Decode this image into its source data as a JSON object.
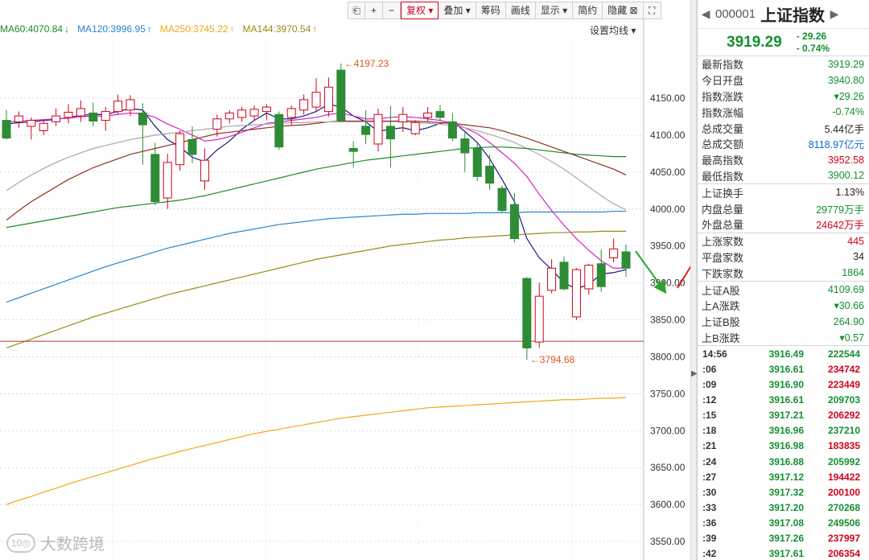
{
  "toolbar": {
    "buttons": [
      {
        "label": "⎗",
        "icon": "copy-icon"
      },
      {
        "label": "+",
        "icon": "zoom-in-icon"
      },
      {
        "label": "−",
        "icon": "zoom-out-icon"
      },
      {
        "label": "复权 ▾",
        "active": true
      },
      {
        "label": "叠加 ▾"
      },
      {
        "label": "筹码"
      },
      {
        "label": "画线"
      },
      {
        "label": "显示 ▾"
      },
      {
        "label": "简约"
      },
      {
        "label": "隐藏 ⊠"
      },
      {
        "label": "⛶",
        "icon": "fullscreen-icon"
      }
    ]
  },
  "ma_legend": [
    {
      "label": "MA60:4070.84",
      "arrow": "↓",
      "color": "#1b8a28"
    },
    {
      "label": "MA120:3996.95",
      "arrow": "↑",
      "color": "#2a86d1"
    },
    {
      "label": "MA250:3745.22",
      "arrow": "↑",
      "color": "#f0a818"
    },
    {
      "label": "MA144:3970.54",
      "arrow": "↑",
      "color": "#9a8a1a"
    }
  ],
  "ma_settings": "设置均线 ▾",
  "watermark": "大数跨境",
  "chart_data": {
    "type": "candlestick",
    "y_ticks": [
      4150,
      4100,
      4050,
      4000,
      3950,
      3900,
      3850,
      3800,
      3750,
      3700,
      3650,
      3600,
      3550
    ],
    "ylim": [
      3525,
      4235
    ],
    "candles": [
      {
        "o": 4120,
        "h": 4134,
        "l": 4094,
        "c": 4096
      },
      {
        "o": 4118,
        "h": 4132,
        "l": 4110,
        "c": 4126
      },
      {
        "o": 4112,
        "h": 4124,
        "l": 4094,
        "c": 4120
      },
      {
        "o": 4106,
        "h": 4121,
        "l": 4100,
        "c": 4116
      },
      {
        "o": 4118,
        "h": 4136,
        "l": 4112,
        "c": 4126
      },
      {
        "o": 4124,
        "h": 4142,
        "l": 4116,
        "c": 4131
      },
      {
        "o": 4126,
        "h": 4147,
        "l": 4118,
        "c": 4136
      },
      {
        "o": 4130,
        "h": 4144,
        "l": 4112,
        "c": 4119
      },
      {
        "o": 4120,
        "h": 4138,
        "l": 4106,
        "c": 4132
      },
      {
        "o": 4132,
        "h": 4155,
        "l": 4128,
        "c": 4146
      },
      {
        "o": 4134,
        "h": 4154,
        "l": 4126,
        "c": 4148
      },
      {
        "o": 4130,
        "h": 4143,
        "l": 4060,
        "c": 4114
      },
      {
        "o": 4074,
        "h": 4090,
        "l": 4005,
        "c": 4010
      },
      {
        "o": 4015,
        "h": 4075,
        "l": 4000,
        "c": 4063
      },
      {
        "o": 4060,
        "h": 4106,
        "l": 4052,
        "c": 4102
      },
      {
        "o": 4094,
        "h": 4112,
        "l": 4062,
        "c": 4074
      },
      {
        "o": 4038,
        "h": 4082,
        "l": 4026,
        "c": 4066
      },
      {
        "o": 4108,
        "h": 4128,
        "l": 4098,
        "c": 4122
      },
      {
        "o": 4122,
        "h": 4134,
        "l": 4116,
        "c": 4130
      },
      {
        "o": 4124,
        "h": 4138,
        "l": 4118,
        "c": 4134
      },
      {
        "o": 4126,
        "h": 4140,
        "l": 4120,
        "c": 4135
      },
      {
        "o": 4132,
        "h": 4142,
        "l": 4120,
        "c": 4138
      },
      {
        "o": 4128,
        "h": 4132,
        "l": 4080,
        "c": 4084
      },
      {
        "o": 4124,
        "h": 4140,
        "l": 4114,
        "c": 4136
      },
      {
        "o": 4134,
        "h": 4155,
        "l": 4128,
        "c": 4148
      },
      {
        "o": 4138,
        "h": 4177,
        "l": 4132,
        "c": 4158
      },
      {
        "o": 4132,
        "h": 4178,
        "l": 4125,
        "c": 4165
      },
      {
        "o": 4188,
        "h": 4197,
        "l": 4118,
        "c": 4120
      },
      {
        "o": 4082,
        "h": 4092,
        "l": 4056,
        "c": 4078
      },
      {
        "o": 4112,
        "h": 4134,
        "l": 4088,
        "c": 4101
      },
      {
        "o": 4088,
        "h": 4136,
        "l": 4078,
        "c": 4128
      },
      {
        "o": 4112,
        "h": 4140,
        "l": 4056,
        "c": 4095
      },
      {
        "o": 4118,
        "h": 4138,
        "l": 4104,
        "c": 4128
      },
      {
        "o": 4102,
        "h": 4120,
        "l": 4100,
        "c": 4117
      },
      {
        "o": 4124,
        "h": 4138,
        "l": 4118,
        "c": 4130
      },
      {
        "o": 4132,
        "h": 4141,
        "l": 4120,
        "c": 4124
      },
      {
        "o": 4118,
        "h": 4130,
        "l": 4092,
        "c": 4096
      },
      {
        "o": 4095,
        "h": 4104,
        "l": 4050,
        "c": 4076
      },
      {
        "o": 4082,
        "h": 4090,
        "l": 4038,
        "c": 4044
      },
      {
        "o": 4058,
        "h": 4074,
        "l": 4026,
        "c": 4035
      },
      {
        "o": 4028,
        "h": 4032,
        "l": 3996,
        "c": 3998
      },
      {
        "o": 4006,
        "h": 4022,
        "l": 3955,
        "c": 3960
      },
      {
        "o": 3906,
        "h": 3908,
        "l": 3796,
        "c": 3812
      },
      {
        "o": 3820,
        "h": 3900,
        "l": 3812,
        "c": 3882
      },
      {
        "o": 3890,
        "h": 3932,
        "l": 3886,
        "c": 3920
      },
      {
        "o": 3928,
        "h": 3936,
        "l": 3890,
        "c": 3892
      },
      {
        "o": 3854,
        "h": 3920,
        "l": 3850,
        "c": 3918
      },
      {
        "o": 3892,
        "h": 3926,
        "l": 3884,
        "c": 3924
      },
      {
        "o": 3926,
        "h": 3945,
        "l": 3888,
        "c": 3895
      },
      {
        "o": 3934,
        "h": 3960,
        "l": 3928,
        "c": 3946
      },
      {
        "o": 3942,
        "h": 3952,
        "l": 3908,
        "c": 3920
      }
    ],
    "ma_lines": [
      {
        "name": "MA5",
        "color": "#1a1a80",
        "values": [
          4115,
          4117,
          4118,
          4120,
          4121,
          4124,
          4127,
          4128,
          4128,
          4132,
          4136,
          4134,
          4112,
          4094,
          4084,
          4070,
          4064,
          4080,
          4092,
          4108,
          4120,
          4130,
          4122,
          4122,
          4126,
          4132,
          4142,
          4138,
          4126,
          4118,
          4105,
          4108,
          4110,
          4106,
          4110,
          4116,
          4118,
          4105,
          4090,
          4068,
          4040,
          4010,
          3960,
          3934,
          3918,
          3900,
          3892,
          3898,
          3912,
          3914,
          3918
        ]
      },
      {
        "name": "MA10",
        "color": "#d920c8",
        "values": [
          4118,
          4119,
          4120,
          4121,
          4122,
          4123,
          4125,
          4126,
          4126,
          4128,
          4130,
          4129,
          4124,
          4115,
          4108,
          4100,
          4092,
          4094,
          4098,
          4104,
          4110,
          4116,
          4118,
          4120,
          4122,
          4124,
          4128,
          4130,
          4126,
          4122,
          4122,
          4124,
          4125,
          4124,
          4122,
          4120,
          4116,
          4110,
          4102,
          4090,
          4076,
          4062,
          4044,
          4020,
          3998,
          3978,
          3960,
          3944,
          3930,
          3920,
          3920
        ]
      },
      {
        "name": "MA20",
        "color": "#8c3020",
        "values": [
          3985,
          3998,
          4010,
          4020,
          4030,
          4040,
          4048,
          4056,
          4062,
          4068,
          4074,
          4078,
          4082,
          4086,
          4090,
          4094,
          4098,
          4102,
          4104,
          4106,
          4108,
          4110,
          4112,
          4113,
          4114,
          4116,
          4118,
          4119,
          4119,
          4119,
          4119,
          4119,
          4119,
          4119,
          4118,
          4117,
          4116,
          4114,
          4112,
          4110,
          4106,
          4101,
          4096,
          4090,
          4084,
          4078,
          4072,
          4066,
          4060,
          4054,
          4046
        ]
      },
      {
        "name": "MA30",
        "color": "#a8a8a8",
        "values": [
          4025,
          4036,
          4046,
          4055,
          4063,
          4070,
          4076,
          4082,
          4086,
          4090,
          4094,
          4097,
          4100,
          4102,
          4104,
          4106,
          4108,
          4110,
          4112,
          4113,
          4114,
          4115,
          4116,
          4117,
          4117,
          4118,
          4118,
          4118,
          4118,
          4118,
          4118,
          4118,
          4118,
          4117,
          4116,
          4115,
          4113,
          4110,
          4106,
          4101,
          4096,
          4090,
          4082,
          4074,
          4064,
          4054,
          4042,
          4030,
          4018,
          4007,
          3999
        ]
      },
      {
        "name": "MA60",
        "color": "#1b8a28",
        "values": [
          3975,
          3978,
          3981,
          3984,
          3987,
          3990,
          3993,
          3996,
          3999,
          4002,
          4004,
          4006,
          4008,
          4010,
          4012,
          4015,
          4018,
          4022,
          4026,
          4030,
          4034,
          4038,
          4042,
          4046,
          4050,
          4054,
          4057,
          4060,
          4063,
          4066,
          4068,
          4070,
          4072,
          4074,
          4076,
          4078,
          4080,
          4082,
          4083,
          4084,
          4084,
          4083,
          4082,
          4080,
          4078,
          4076,
          4074,
          4073,
          4072,
          4071,
          4071
        ]
      },
      {
        "name": "MA120",
        "color": "#2a86d1",
        "values": [
          3874,
          3880,
          3886,
          3892,
          3898,
          3904,
          3910,
          3916,
          3922,
          3927,
          3932,
          3937,
          3942,
          3947,
          3951,
          3955,
          3959,
          3963,
          3967,
          3970,
          3973,
          3976,
          3979,
          3981,
          3983,
          3985,
          3987,
          3988,
          3989,
          3990,
          3991,
          3992,
          3993,
          3993,
          3994,
          3994,
          3994,
          3994,
          3995,
          3995,
          3995,
          3995,
          3996,
          3996,
          3996,
          3996,
          3996,
          3996,
          3996,
          3997,
          3997
        ]
      },
      {
        "name": "MA144",
        "color": "#9a8a1a",
        "values": [
          3812,
          3818,
          3824,
          3830,
          3836,
          3842,
          3848,
          3854,
          3859,
          3864,
          3869,
          3874,
          3879,
          3884,
          3888,
          3892,
          3896,
          3900,
          3904,
          3908,
          3912,
          3916,
          3920,
          3924,
          3928,
          3932,
          3935,
          3938,
          3941,
          3944,
          3947,
          3950,
          3952,
          3954,
          3956,
          3958,
          3959,
          3961,
          3962,
          3963,
          3964,
          3965,
          3966,
          3967,
          3968,
          3968,
          3969,
          3969,
          3970,
          3970,
          3970
        ]
      },
      {
        "name": "MA250",
        "color": "#f0a818",
        "values": [
          3600,
          3606,
          3611,
          3617,
          3622,
          3628,
          3633,
          3638,
          3643,
          3648,
          3653,
          3658,
          3663,
          3667,
          3672,
          3676,
          3680,
          3684,
          3688,
          3692,
          3696,
          3699,
          3702,
          3705,
          3708,
          3711,
          3714,
          3717,
          3719,
          3721,
          3723,
          3725,
          3727,
          3729,
          3731,
          3732,
          3733,
          3734,
          3735,
          3736,
          3737,
          3738,
          3739,
          3740,
          3741,
          3742,
          3742,
          3743,
          3744,
          3744,
          3745
        ]
      }
    ],
    "support_line": 3821,
    "annotations": {
      "high": "←4197.23",
      "low": "←3794.68"
    }
  },
  "side": {
    "code": "000001",
    "name": "上证指数",
    "price": "3919.29",
    "change": "- 29.26",
    "change_pct": "- 0.74%",
    "stats_a": [
      {
        "k": "最新指数",
        "v": "3919.29",
        "cls": "green"
      },
      {
        "k": "今日开盘",
        "v": "3940.80",
        "cls": "green"
      },
      {
        "k": "指数涨跌",
        "v": "▾29.26",
        "cls": "green"
      },
      {
        "k": "指数涨幅",
        "v": "-0.74%",
        "cls": "green"
      },
      {
        "k": "总成交量",
        "v": "5.44亿手",
        "cls": "dark"
      },
      {
        "k": "总成交额",
        "v": "8118.97亿元",
        "cls": "blue"
      },
      {
        "k": "最高指数",
        "v": "3952.58",
        "cls": "red"
      },
      {
        "k": "最低指数",
        "v": "3900.12",
        "cls": "green"
      }
    ],
    "stats_b": [
      {
        "k": "上证换手",
        "v": "1.13%",
        "cls": "dark"
      },
      {
        "k": "内盘总量",
        "v": "29779万手",
        "cls": "green"
      },
      {
        "k": "外盘总量",
        "v": "24642万手",
        "cls": "red"
      }
    ],
    "stats_c": [
      {
        "k": "上涨家数",
        "v": "445",
        "cls": "red"
      },
      {
        "k": "平盘家数",
        "v": "34",
        "cls": "dark"
      },
      {
        "k": "下跌家数",
        "v": "1864",
        "cls": "green"
      }
    ],
    "stats_d": [
      {
        "k": "上证A股",
        "v": "4109.69",
        "cls": "green"
      },
      {
        "k": "上A涨跌",
        "v": "▾30.66",
        "cls": "green"
      },
      {
        "k": "上证B股",
        "v": "264.90",
        "cls": "green"
      },
      {
        "k": "上B涨跌",
        "v": "▾0.57",
        "cls": "green"
      }
    ],
    "ticks": [
      {
        "t": "14:56",
        "p": "3916.49",
        "v": "222544",
        "cls": "green"
      },
      {
        "t": ":06",
        "p": "3916.61",
        "v": "234742",
        "cls": "red"
      },
      {
        "t": ":09",
        "p": "3916.90",
        "v": "223449",
        "cls": "red"
      },
      {
        "t": ":12",
        "p": "3916.61",
        "v": "209703",
        "cls": "green"
      },
      {
        "t": ":15",
        "p": "3917.21",
        "v": "206292",
        "cls": "red"
      },
      {
        "t": ":18",
        "p": "3916.96",
        "v": "237210",
        "cls": "green"
      },
      {
        "t": ":21",
        "p": "3916.98",
        "v": "183835",
        "cls": "red"
      },
      {
        "t": ":24",
        "p": "3916.88",
        "v": "205992",
        "cls": "green"
      },
      {
        "t": ":27",
        "p": "3917.12",
        "v": "194422",
        "cls": "red"
      },
      {
        "t": ":30",
        "p": "3917.32",
        "v": "200100",
        "cls": "red"
      },
      {
        "t": ":33",
        "p": "3917.20",
        "v": "270268",
        "cls": "green"
      },
      {
        "t": ":36",
        "p": "3917.08",
        "v": "249506",
        "cls": "green"
      },
      {
        "t": ":39",
        "p": "3917.26",
        "v": "237997",
        "cls": "red"
      },
      {
        "t": ":42",
        "p": "3917.61",
        "v": "206354",
        "cls": "red"
      }
    ]
  }
}
